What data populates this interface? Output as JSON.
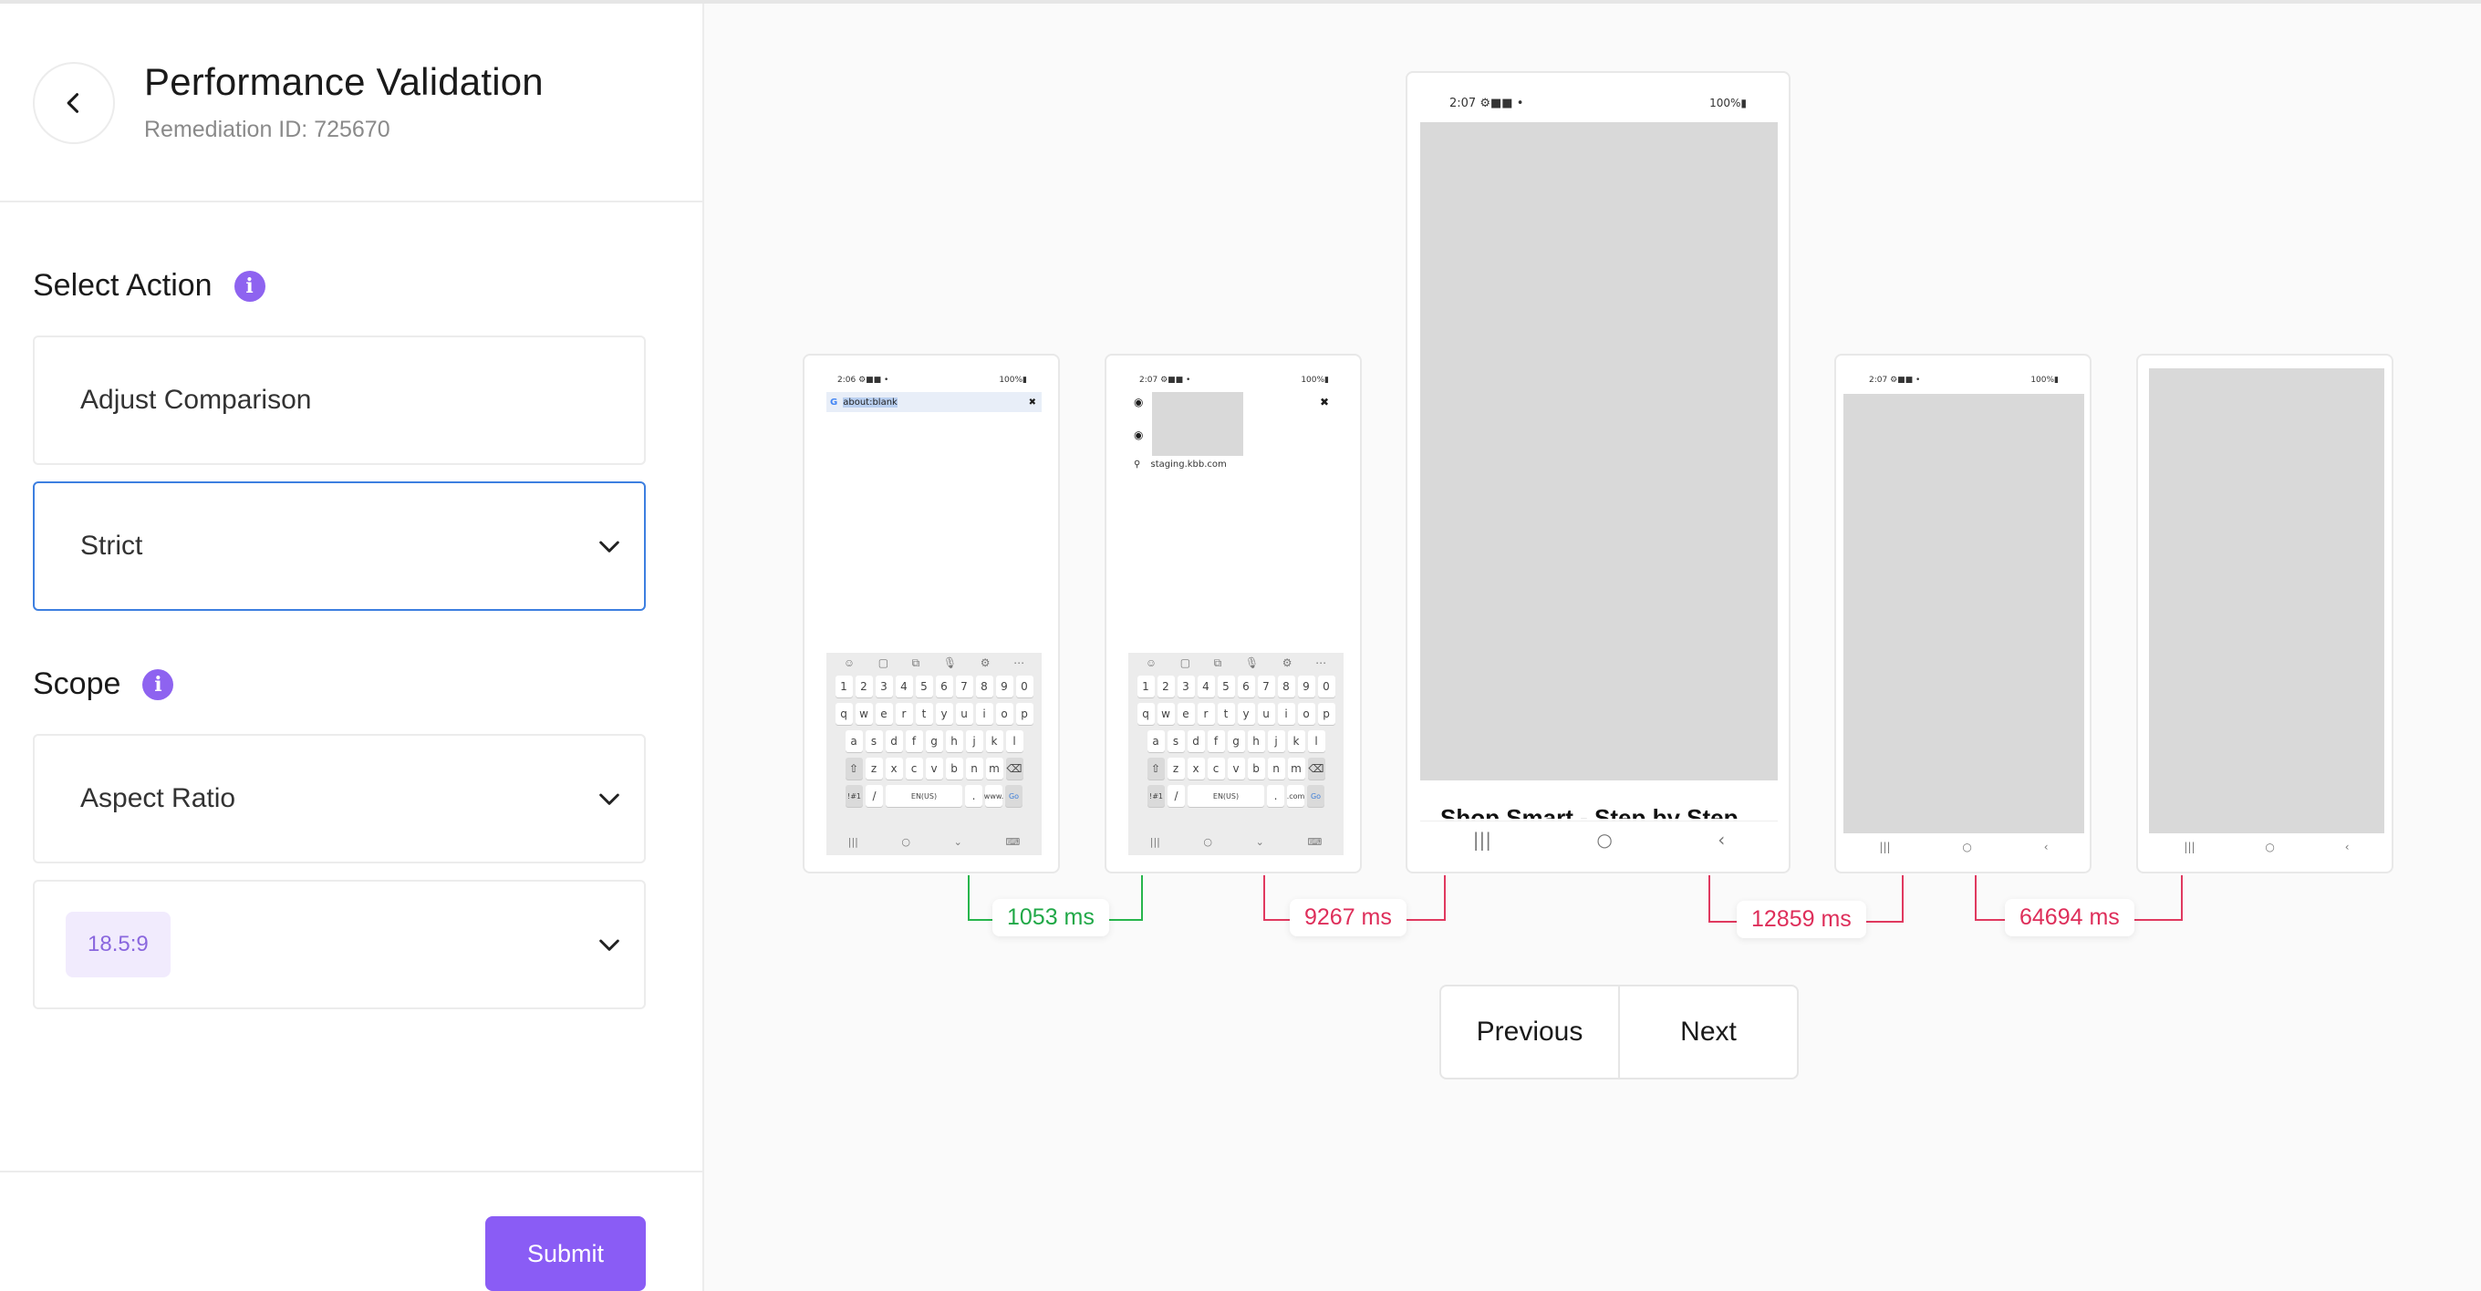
{
  "header": {
    "title": "Performance Validation",
    "subtitle": "Remediation ID: 725670"
  },
  "select_action": {
    "label": "Select Action",
    "action_value": "Adjust Comparison",
    "mode_value": "Strict"
  },
  "scope": {
    "label": "Scope",
    "scope_value": "Aspect Ratio",
    "ratio_chip": "18.5:9"
  },
  "submit_label": "Submit",
  "pager": {
    "previous": "Previous",
    "next": "Next"
  },
  "phones": [
    {
      "status_time": "2:06",
      "status_right": "100%",
      "url": "about:blank",
      "keys_row1": [
        "1",
        "2",
        "3",
        "4",
        "5",
        "6",
        "7",
        "8",
        "9",
        "0"
      ],
      "keys_row2": [
        "q",
        "w",
        "e",
        "r",
        "t",
        "y",
        "u",
        "i",
        "o",
        "p"
      ],
      "keys_row3": [
        "a",
        "s",
        "d",
        "f",
        "g",
        "h",
        "j",
        "k",
        "l"
      ],
      "keys_row4": [
        "z",
        "x",
        "c",
        "v",
        "b",
        "n",
        "m"
      ],
      "key_sym": "!#1",
      "key_slash": "/",
      "key_lang": "EN(US)",
      "key_dot": ".",
      "key_www": "www.",
      "key_go": "Go"
    },
    {
      "status_time": "2:07",
      "status_right": "100%",
      "suggestion": "staging.kbb.com",
      "key_sym": "!#1",
      "key_slash": "/",
      "key_lang": "EN(US)",
      "key_dot": ".",
      "key_com": ".com",
      "key_go": "Go"
    },
    {
      "status_time": "2:07",
      "status_right": "100%",
      "bottom_text": "Shop Smart - Step by Step"
    },
    {
      "status_time": "2:07",
      "status_right": "100%"
    },
    {}
  ],
  "timings": [
    "1053 ms",
    "9267 ms",
    "12859 ms",
    "64694 ms"
  ],
  "colors": {
    "accent": "#8a5cf5",
    "focus_border": "#3d7fe0",
    "timing_ok": "#20a847",
    "timing_bad": "#de2e5a"
  }
}
